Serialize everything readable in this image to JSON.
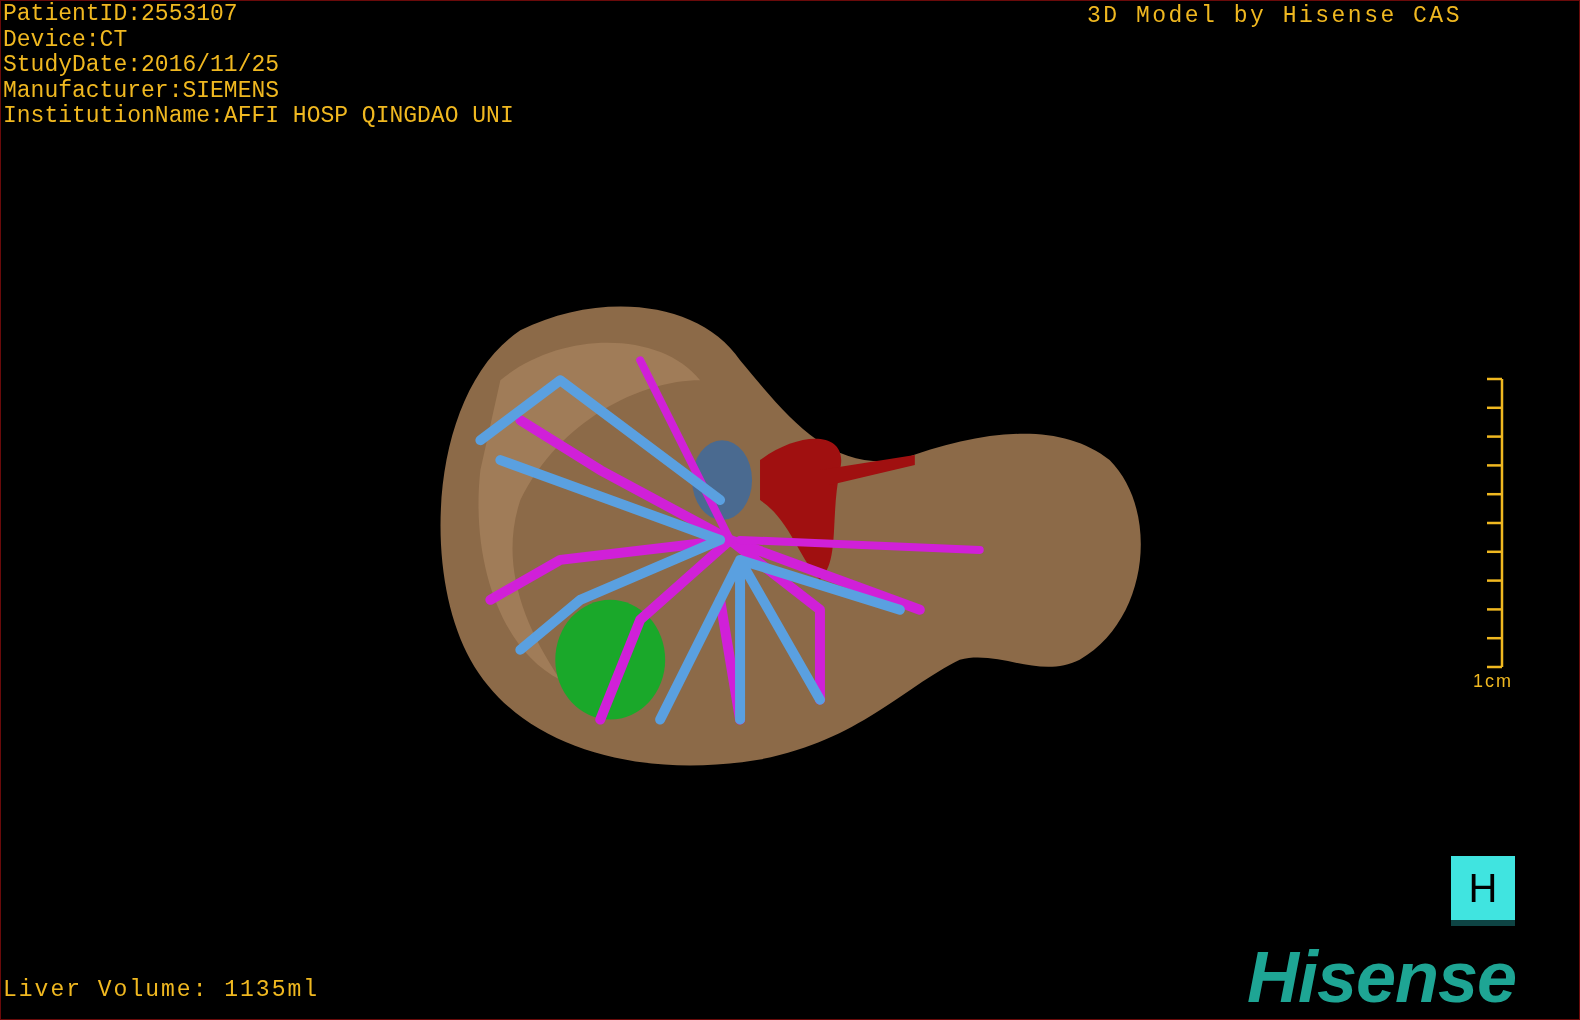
{
  "patient_info": [
    "PatientID:2553107",
    "Device:CT",
    "StudyDate:2016/11/25",
    "Manufacturer:SIEMENS",
    "InstitutionName:AFFI HOSP QINGDAO UNI"
  ],
  "title": "3D Model by Hisense CAS",
  "scale": {
    "label": "1cm"
  },
  "orientation_cube": {
    "label": "H"
  },
  "logo": "Hisense",
  "liver_volume": "Liver Volume: 1135ml"
}
